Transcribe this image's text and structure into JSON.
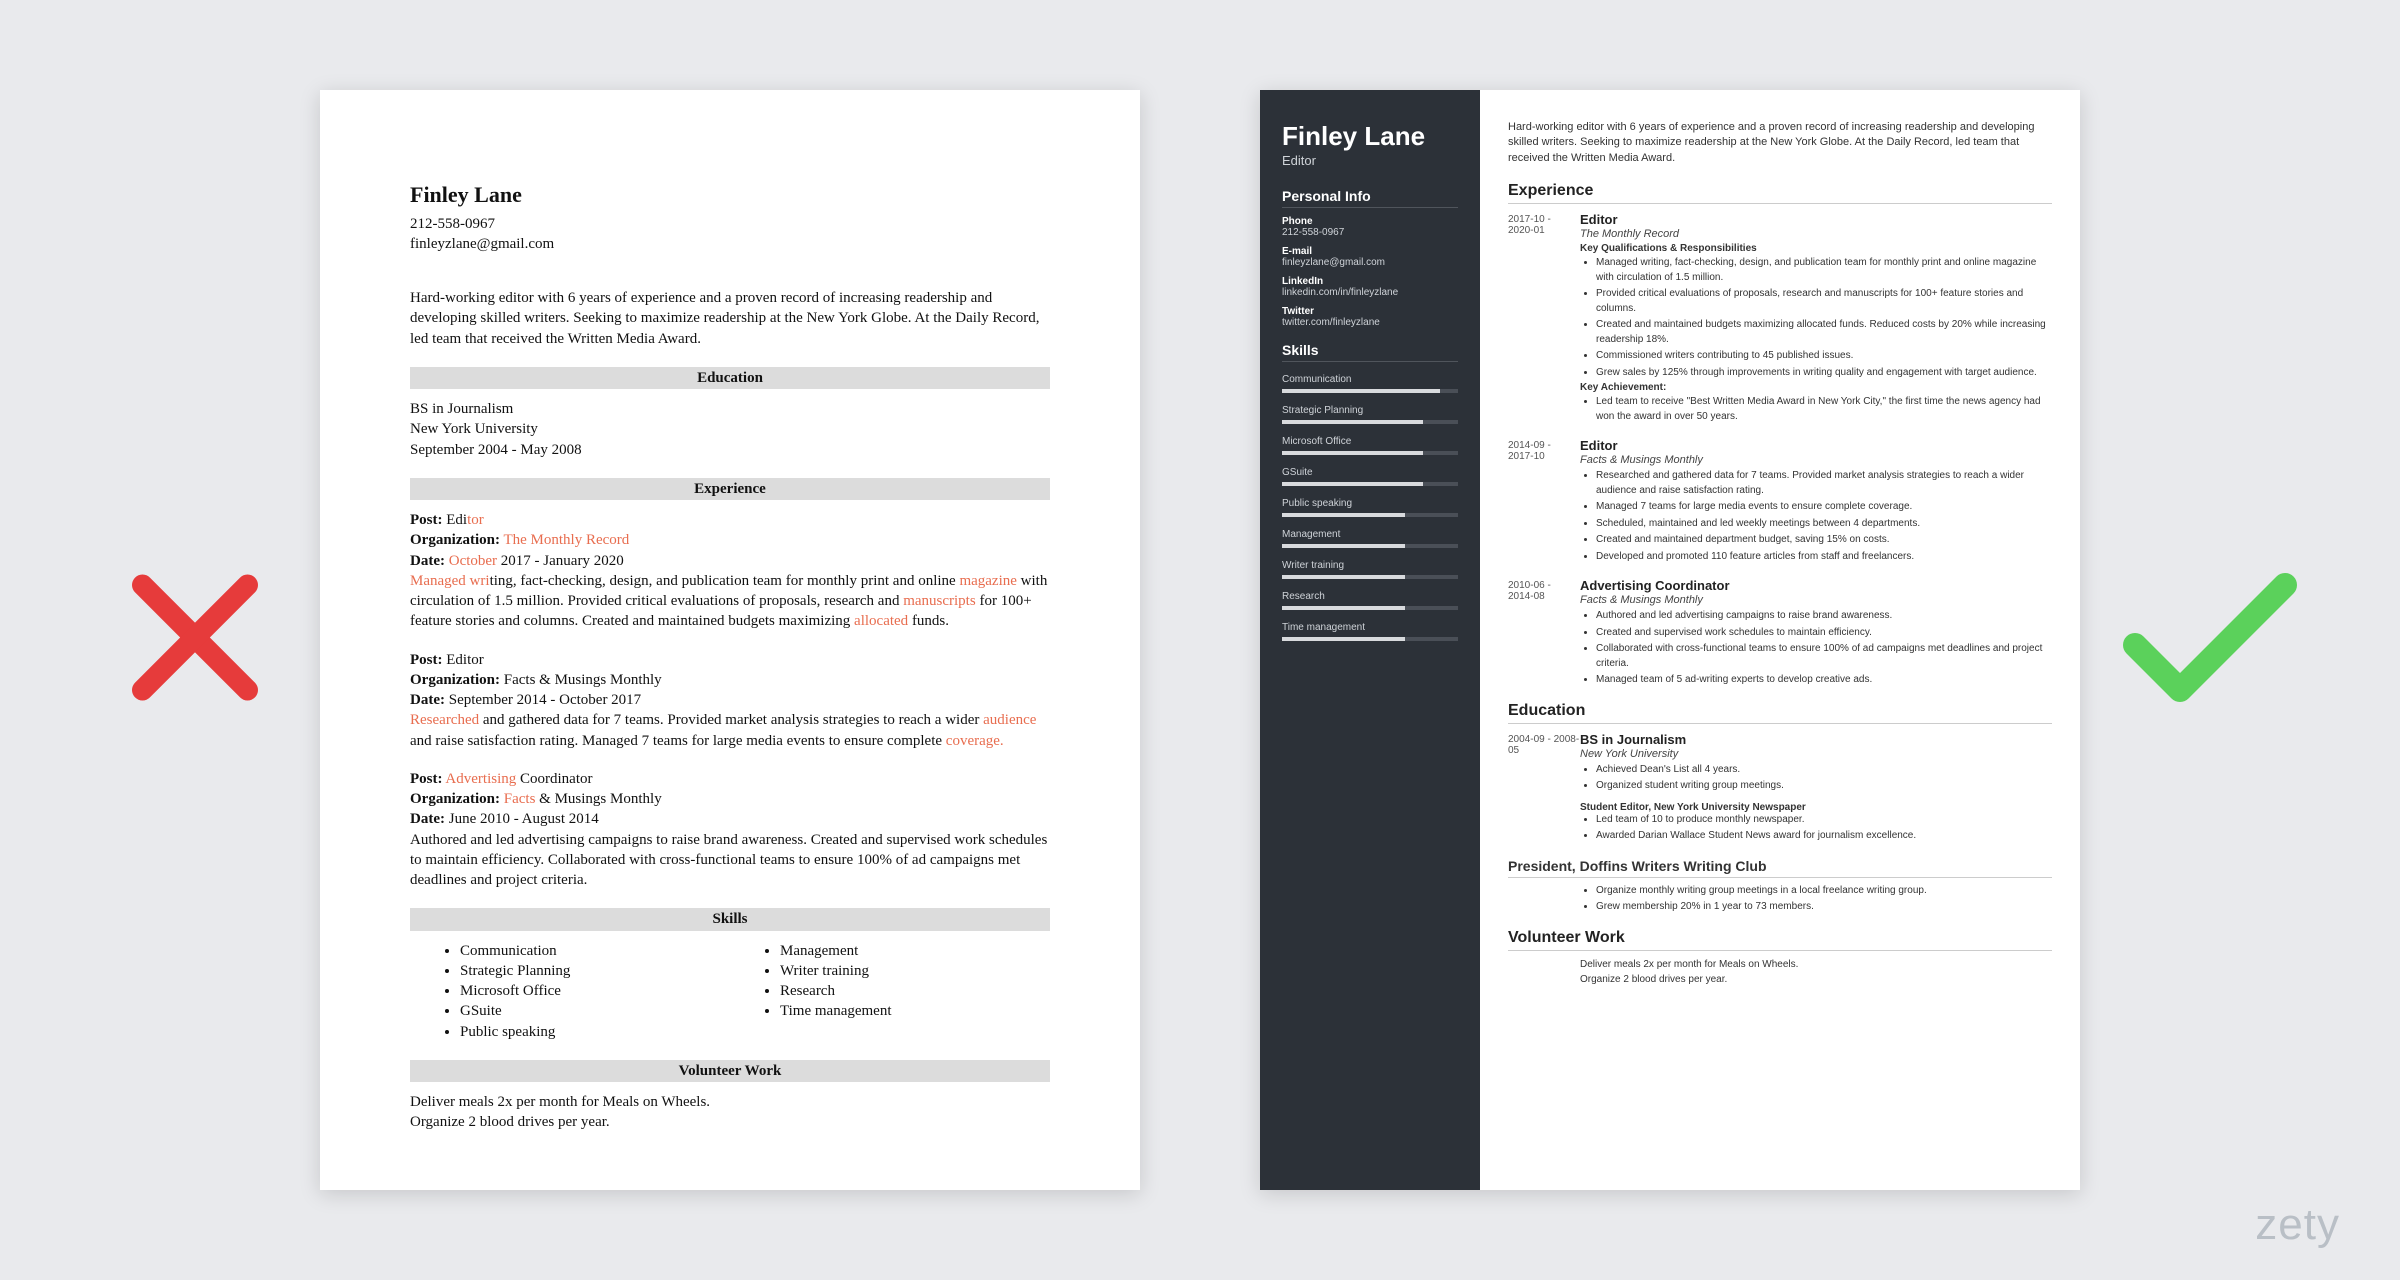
{
  "brand": "zety",
  "common": {
    "name": "Finley Lane",
    "phone": "212-558-0967",
    "email": "finleyzlane@gmail.com",
    "summary": "Hard-working editor with 6 years of experience and a proven record of increasing readership and developing skilled writers. Seeking to maximize readership at the New York Globe. At the Daily Record, led team that received the Written Media Award."
  },
  "left": {
    "section_education": "Education",
    "degree": "BS in Journalism",
    "school": "New York University",
    "edu_dates": "September 2004 - May 2008",
    "section_experience": "Experience",
    "label_post": "Post:",
    "label_org": "Organization:",
    "label_date": "Date:",
    "post1_title_pre": " Edi",
    "post1_title_hl": "tor",
    "post1_org": " The Monthly Record",
    "post1_date_hl": " October",
    "post1_date_rest": " 2017 - January 2020",
    "post1_body_hl1": "Managed wri",
    "post1_body_mid1": "ting, fact-checking, design, and publication team for monthly print and online ",
    "post1_body_hl2": "magazine",
    "post1_body_mid2": " with circulation of 1.5 million. Provided critical evaluations of proposals, research and ",
    "post1_body_hl3": "manuscripts",
    "post1_body_mid3": " for 100+ feature stories and columns. Created and maintained budgets maximizing ",
    "post1_body_hl4": "allocated",
    "post1_body_end": " funds.",
    "post2_title": " Editor",
    "post2_org": " Facts & Musings Monthly",
    "post2_date": " September 2014 - October 2017",
    "post2_body_hl1": "Researched",
    "post2_body_mid1": " and gathered data for 7 teams. Provided market analysis strategies to reach a wider ",
    "post2_body_hl2": "audience",
    "post2_body_mid2": " and raise satisfaction rating. Managed 7 teams for large media events to ensure complete ",
    "post2_body_hl3": "coverage.",
    "post3_title_hl": " Advertising",
    "post3_title_rest": " Coordinator",
    "post3_org_hl": " Facts",
    "post3_org_rest": " & Musings Monthly",
    "post3_date": " June 2010 - August 2014",
    "post3_body": "Authored and led advertising campaigns to raise brand awareness. Created and supervised work schedules to maintain efficiency. Collaborated with cross-functional teams to ensure 100% of ad campaigns met deadlines and project criteria.",
    "section_skills": "Skills",
    "skills_l": [
      "Communication",
      "Strategic Planning",
      "Microsoft Office",
      "GSuite",
      "Public speaking"
    ],
    "skills_r": [
      "Management",
      "Writer training",
      "Research",
      "Time management"
    ],
    "section_volunteer": "Volunteer Work",
    "vol1": "Deliver meals 2x per month for Meals on Wheels.",
    "vol2": "Organize 2 blood drives per year."
  },
  "right": {
    "role": "Editor",
    "sec_personal": "Personal Info",
    "info": {
      "phone_l": "Phone",
      "phone_v": "212-558-0967",
      "email_l": "E-mail",
      "email_v": "finleyzlane@gmail.com",
      "li_l": "LinkedIn",
      "li_v": "linkedin.com/in/finleyzlane",
      "tw_l": "Twitter",
      "tw_v": "twitter.com/finleyzlane"
    },
    "sec_skills": "Skills",
    "skills": [
      {
        "nm": "Communication",
        "v": 90
      },
      {
        "nm": "Strategic Planning",
        "v": 80
      },
      {
        "nm": "Microsoft Office",
        "v": 80
      },
      {
        "nm": "GSuite",
        "v": 80
      },
      {
        "nm": "Public speaking",
        "v": 70
      },
      {
        "nm": "Management",
        "v": 70
      },
      {
        "nm": "Writer training",
        "v": 70
      },
      {
        "nm": "Research",
        "v": 70
      },
      {
        "nm": "Time management",
        "v": 70
      }
    ],
    "sec_experience": "Experience",
    "jobs": [
      {
        "dates": "2017-10 - 2020-01",
        "title": "Editor",
        "org": "The Monthly Record",
        "sub1": "Key Qualifications & Responsibilities",
        "items": [
          "Managed writing, fact-checking, design, and publication team for monthly print and online magazine with circulation of 1.5 million.",
          "Provided critical evaluations of proposals, research and manuscripts for 100+ feature stories and columns.",
          "Created and maintained budgets maximizing allocated funds. Reduced costs by 20% while increasing readership 18%.",
          "Commissioned writers contributing to 45 published issues.",
          "Grew sales by 125% through improvements in writing quality and engagement with target audience."
        ],
        "sub2": "Key Achievement:",
        "items2": [
          "Led team to receive \"Best Written Media Award in New York City,\" the first time the news agency had won the award in over 50 years."
        ]
      },
      {
        "dates": "2014-09 - 2017-10",
        "title": "Editor",
        "org": "Facts & Musings Monthly",
        "items": [
          "Researched and gathered data for 7 teams. Provided market analysis strategies to reach a wider audience and raise satisfaction rating.",
          "Managed 7 teams for large media events to ensure complete coverage.",
          "Scheduled, maintained and led weekly meetings between 4 departments.",
          "Created and maintained department budget, saving 15% on costs.",
          "Developed and promoted 110 feature articles from staff and freelancers."
        ]
      },
      {
        "dates": "2010-06 - 2014-08",
        "title": "Advertising Coordinator",
        "org": "Facts & Musings Monthly",
        "items": [
          "Authored and led advertising campaigns to raise brand awareness.",
          "Created and supervised work schedules to maintain efficiency.",
          "Collaborated with cross-functional teams to ensure 100% of ad campaigns met deadlines and project criteria.",
          "Managed team of 5 ad-writing experts to develop creative ads."
        ]
      }
    ],
    "sec_education": "Education",
    "edu_dates": "2004-09 - 2008-05",
    "edu_title": "BS in Journalism",
    "edu_org": "New York University",
    "edu_items": [
      "Achieved Dean's List all 4 years.",
      "Organized student writing group meetings."
    ],
    "student_editor": "Student Editor, New York University Newspaper",
    "student_items": [
      "Led team of 10 to produce monthly newspaper.",
      "Awarded Darian Wallace Student News award for journalism excellence."
    ],
    "club_title": "President, Doffins Writers Writing Club",
    "club_items": [
      "Organize monthly writing group meetings in a local freelance writing group.",
      "Grew membership 20% in 1 year to 73 members."
    ],
    "sec_volunteer": "Volunteer Work",
    "vol1": "Deliver meals 2x per month for Meals on Wheels.",
    "vol2": "Organize 2 blood drives per year."
  }
}
